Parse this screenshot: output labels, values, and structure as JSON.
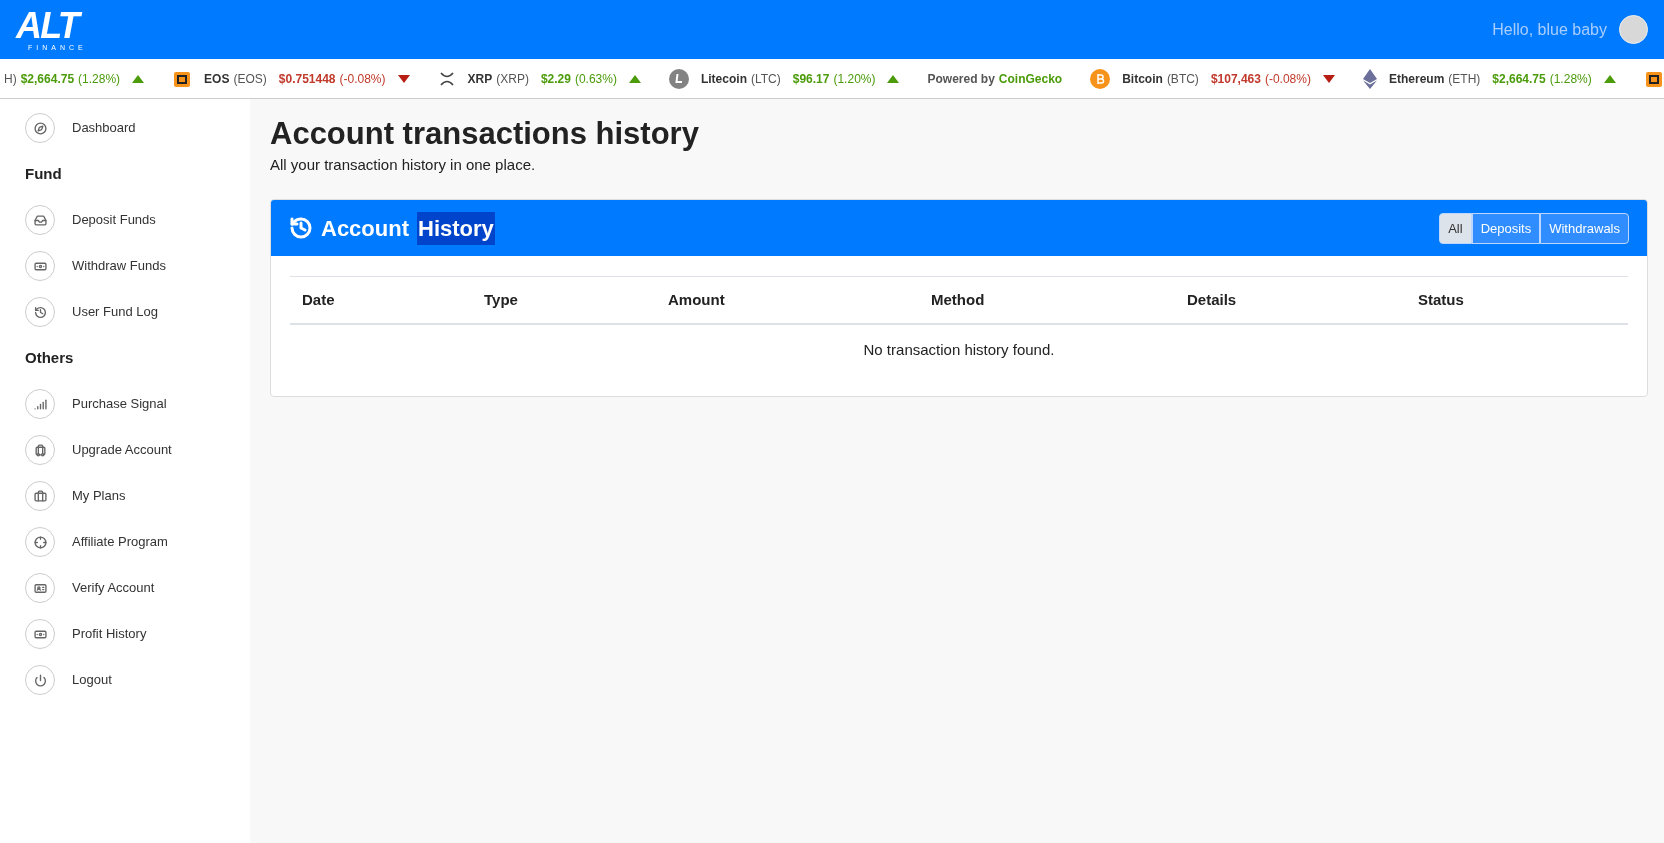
{
  "header": {
    "logo_text": "ALT",
    "logo_subtext": "FINANCE",
    "greeting": "Hello, blue baby"
  },
  "ticker": [
    {
      "kind": "partial",
      "label": "H)",
      "price": "$2,664.75",
      "change": "(1.28%)",
      "rising": true
    },
    {
      "kind": "coin",
      "name": "EOS",
      "symbol": "(EOS)",
      "price": "$0.751448",
      "change": "(-0.08%)",
      "rising": false
    },
    {
      "kind": "coin",
      "name": "XRP",
      "symbol": "(XRP)",
      "price": "$2.29",
      "change": "(0.63%)",
      "rising": true
    },
    {
      "kind": "coin",
      "name": "Litecoin",
      "symbol": "(LTC)",
      "price": "$96.17",
      "change": "(1.20%)",
      "rising": true
    },
    {
      "kind": "credit",
      "label": "Powered by",
      "brand": "CoinGecko"
    },
    {
      "kind": "coin",
      "name": "Bitcoin",
      "symbol": "(BTC)",
      "price": "$107,463",
      "change": "(-0.08%)",
      "rising": false
    },
    {
      "kind": "coin",
      "name": "Ethereum",
      "symbol": "(ETH)",
      "price": "$2,664.75",
      "change": "(1.28%)",
      "rising": true
    },
    {
      "kind": "icon_only"
    }
  ],
  "sidebar": [
    {
      "kind": "item",
      "label": "Dashboard"
    },
    {
      "kind": "heading",
      "label": "Fund"
    },
    {
      "kind": "item",
      "label": "Deposit Funds"
    },
    {
      "kind": "item",
      "label": "Withdraw Funds"
    },
    {
      "kind": "item",
      "label": "User Fund Log"
    },
    {
      "kind": "heading",
      "label": "Others"
    },
    {
      "kind": "item",
      "label": "Purchase Signal"
    },
    {
      "kind": "item",
      "label": "Upgrade Account"
    },
    {
      "kind": "item",
      "label": "My Plans"
    },
    {
      "kind": "item",
      "label": "Affiliate Program"
    },
    {
      "kind": "item",
      "label": "Verify Account"
    },
    {
      "kind": "item",
      "label": "Profit History"
    },
    {
      "kind": "item",
      "label": "Logout"
    }
  ],
  "page": {
    "title": "Account transactions history",
    "subtitle": "All your transaction history in one place."
  },
  "card": {
    "title_words": [
      {
        "text": "Account",
        "highlighted": false
      },
      {
        "text": "History",
        "highlighted": true
      }
    ],
    "filters": [
      {
        "label": "All",
        "selected": true
      },
      {
        "label": "Deposits",
        "selected": false
      },
      {
        "label": "Withdrawals",
        "selected": false
      }
    ],
    "table": {
      "columns": [
        "Date",
        "Type",
        "Amount",
        "Method",
        "Details",
        "Status"
      ],
      "empty_message": "No transaction history found."
    }
  }
}
